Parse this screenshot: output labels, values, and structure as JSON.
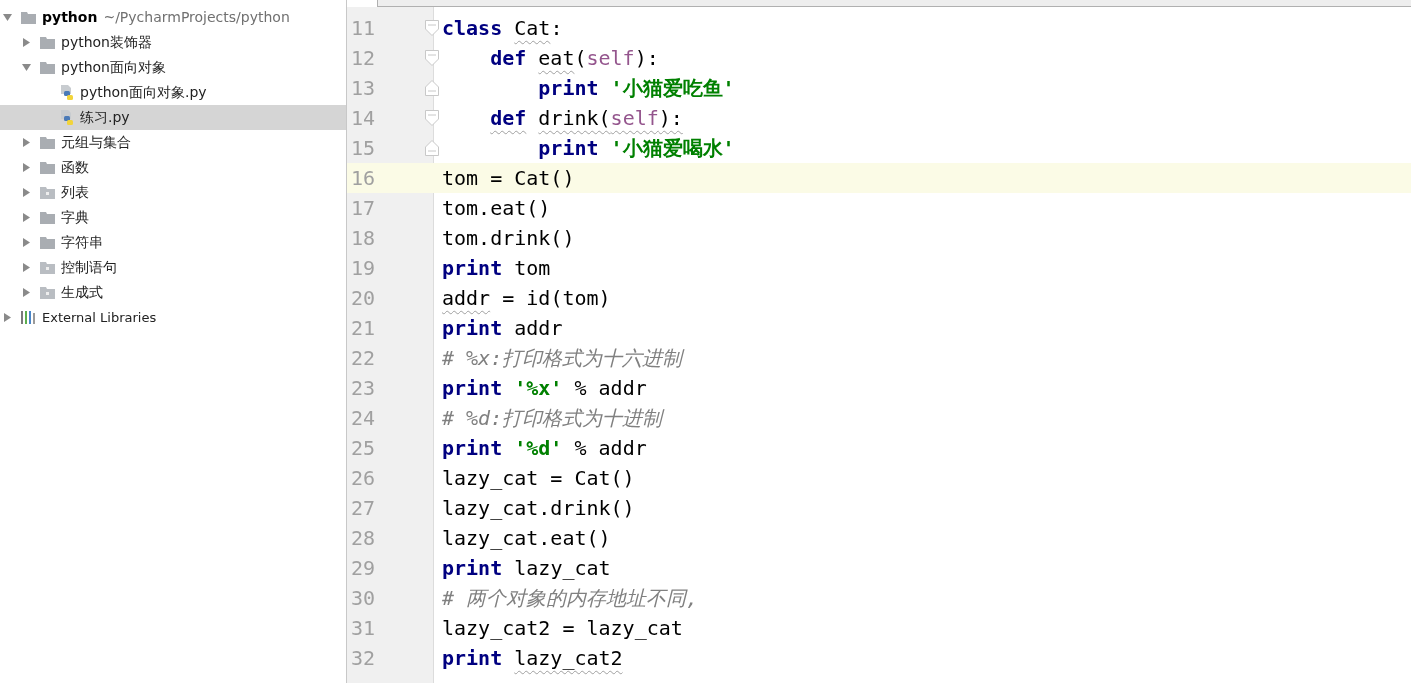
{
  "project_tree": {
    "root": {
      "name": "python",
      "path": "~/PycharmProjects/python",
      "expanded": true,
      "children": [
        {
          "kind": "folder",
          "name": "python装饰器",
          "expanded": false,
          "selected": false
        },
        {
          "kind": "folder",
          "name": "python面向对象",
          "expanded": true,
          "selected": false,
          "children": [
            {
              "kind": "file",
              "name": "python面向对象.py",
              "selected": false
            },
            {
              "kind": "file",
              "name": "练习.py",
              "selected": true
            }
          ]
        },
        {
          "kind": "folder",
          "name": "元组与集合",
          "expanded": false,
          "selected": false
        },
        {
          "kind": "folder",
          "name": "函数",
          "expanded": false,
          "selected": false
        },
        {
          "kind": "package",
          "name": "列表",
          "expanded": false,
          "selected": false
        },
        {
          "kind": "folder",
          "name": "字典",
          "expanded": false,
          "selected": false
        },
        {
          "kind": "folder",
          "name": "字符串",
          "expanded": false,
          "selected": false
        },
        {
          "kind": "package",
          "name": "控制语句",
          "expanded": false,
          "selected": false
        },
        {
          "kind": "package",
          "name": "生成式",
          "expanded": false,
          "selected": false
        }
      ]
    },
    "external": {
      "name": "External Libraries",
      "expanded": false
    }
  },
  "editor": {
    "lines": [
      {
        "number": "11",
        "current": false,
        "fold_end": false,
        "tokens": [
          {
            "kind": "keyword",
            "text": "class "
          },
          {
            "kind": "text",
            "text": "Cat",
            "underlined": true
          },
          {
            "kind": "text",
            "text": ":"
          }
        ]
      },
      {
        "number": "12",
        "current": false,
        "fold_end": false,
        "tokens": [
          {
            "kind": "keyword",
            "text": "    def "
          },
          {
            "kind": "text",
            "text": "eat",
            "underlined": true
          },
          {
            "kind": "text",
            "text": "("
          },
          {
            "kind": "self",
            "text": "self"
          },
          {
            "kind": "text",
            "text": "):"
          }
        ]
      },
      {
        "number": "13",
        "current": false,
        "fold_end": true,
        "tokens": [
          {
            "kind": "keyword",
            "text": "        print "
          },
          {
            "kind": "string",
            "text": "'小猫爱吃鱼'"
          }
        ]
      },
      {
        "number": "14",
        "current": false,
        "fold_end": false,
        "tokens": [
          {
            "kind": "keyword",
            "text": "    def",
            "underlined": true
          },
          {
            "kind": "text",
            "text": " drink(",
            "underlined": true
          },
          {
            "kind": "self",
            "text": "self",
            "underlined": true
          },
          {
            "kind": "text",
            "text": "):",
            "underlined": true
          }
        ]
      },
      {
        "number": "15",
        "current": false,
        "fold_end": true,
        "tokens": [
          {
            "kind": "keyword",
            "text": "        print "
          },
          {
            "kind": "string",
            "text": "'小猫爱喝水'"
          }
        ]
      },
      {
        "number": "16",
        "current": true,
        "tokens": [
          {
            "kind": "text",
            "text": "tom = Cat()"
          }
        ]
      },
      {
        "number": "17",
        "current": false,
        "tokens": [
          {
            "kind": "text",
            "text": "tom.eat()"
          }
        ]
      },
      {
        "number": "18",
        "current": false,
        "tokens": [
          {
            "kind": "text",
            "text": "tom.drink()"
          }
        ]
      },
      {
        "number": "19",
        "current": false,
        "tokens": [
          {
            "kind": "keyword",
            "text": "print"
          },
          {
            "kind": "text",
            "text": " tom"
          }
        ]
      },
      {
        "number": "20",
        "current": false,
        "tokens": [
          {
            "kind": "text",
            "text": "addr",
            "underlined": true
          },
          {
            "kind": "text",
            "text": " = id(tom)"
          }
        ]
      },
      {
        "number": "21",
        "current": false,
        "tokens": [
          {
            "kind": "keyword",
            "text": "print"
          },
          {
            "kind": "text",
            "text": " addr"
          }
        ]
      },
      {
        "number": "22",
        "current": false,
        "tokens": [
          {
            "kind": "comment",
            "text": "# %x:打印格式为十六进制"
          }
        ]
      },
      {
        "number": "23",
        "current": false,
        "tokens": [
          {
            "kind": "keyword",
            "text": "print "
          },
          {
            "kind": "string",
            "text": "'%x'"
          },
          {
            "kind": "text",
            "text": " % addr"
          }
        ]
      },
      {
        "number": "24",
        "current": false,
        "tokens": [
          {
            "kind": "comment",
            "text": "# %d:打印格式为十进制"
          }
        ]
      },
      {
        "number": "25",
        "current": false,
        "tokens": [
          {
            "kind": "keyword",
            "text": "print "
          },
          {
            "kind": "string",
            "text": "'%d'"
          },
          {
            "kind": "text",
            "text": " % addr"
          }
        ]
      },
      {
        "number": "26",
        "current": false,
        "tokens": [
          {
            "kind": "text",
            "text": "lazy_cat = Cat()"
          }
        ]
      },
      {
        "number": "27",
        "current": false,
        "tokens": [
          {
            "kind": "text",
            "text": "lazy_cat.drink()"
          }
        ]
      },
      {
        "number": "28",
        "current": false,
        "tokens": [
          {
            "kind": "text",
            "text": "lazy_cat.eat()"
          }
        ]
      },
      {
        "number": "29",
        "current": false,
        "tokens": [
          {
            "kind": "keyword",
            "text": "print"
          },
          {
            "kind": "text",
            "text": " lazy_cat"
          }
        ]
      },
      {
        "number": "30",
        "current": false,
        "tokens": [
          {
            "kind": "comment",
            "text": "# 两个对象的内存地址不同,"
          }
        ]
      },
      {
        "number": "31",
        "current": false,
        "tokens": [
          {
            "kind": "text",
            "text": "lazy_cat2 = lazy_cat"
          }
        ]
      },
      {
        "number": "32",
        "current": false,
        "tokens": [
          {
            "kind": "keyword",
            "text": "print "
          },
          {
            "kind": "text",
            "text": "lazy_cat2",
            "underlined": true
          }
        ]
      }
    ]
  }
}
